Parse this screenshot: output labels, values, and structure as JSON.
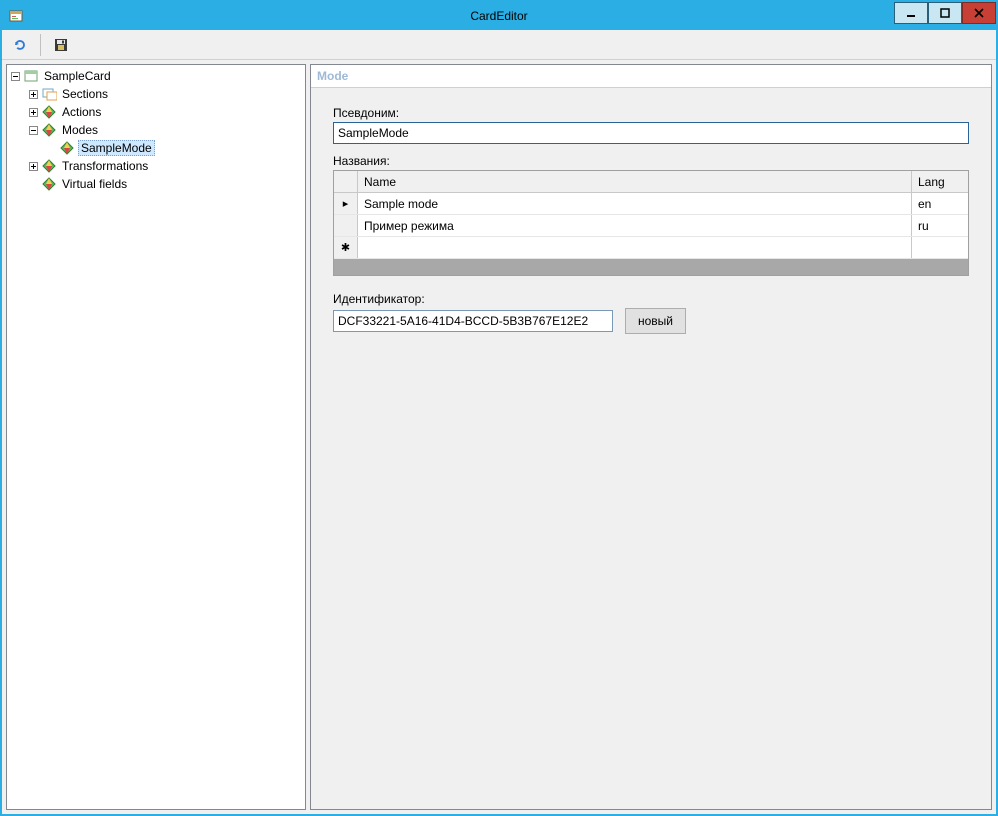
{
  "window": {
    "title": "CardEditor"
  },
  "toolbar": {
    "reload_icon": "reload",
    "save_icon": "save"
  },
  "tree": {
    "root": {
      "label": "SampleCard"
    },
    "sections": {
      "label": "Sections"
    },
    "actions": {
      "label": "Actions"
    },
    "modes": {
      "label": "Modes"
    },
    "samplemode": {
      "label": "SampleMode"
    },
    "transformations": {
      "label": "Transformations"
    },
    "virtualfields": {
      "label": "Virtual fields"
    }
  },
  "detail": {
    "header": "Mode",
    "alias_label": "Псевдоним:",
    "alias_value": "SampleMode",
    "names_label": "Названия:",
    "grid": {
      "cols": {
        "name": "Name",
        "lang": "Lang"
      },
      "rows": [
        {
          "name": "Sample mode",
          "lang": "en"
        },
        {
          "name": "Пример режима",
          "lang": "ru"
        }
      ]
    },
    "id_label": "Идентификатор:",
    "id_value": "DCF33221-5A16-41D4-BCCD-5B3B767E12E2",
    "new_btn": "новый"
  }
}
